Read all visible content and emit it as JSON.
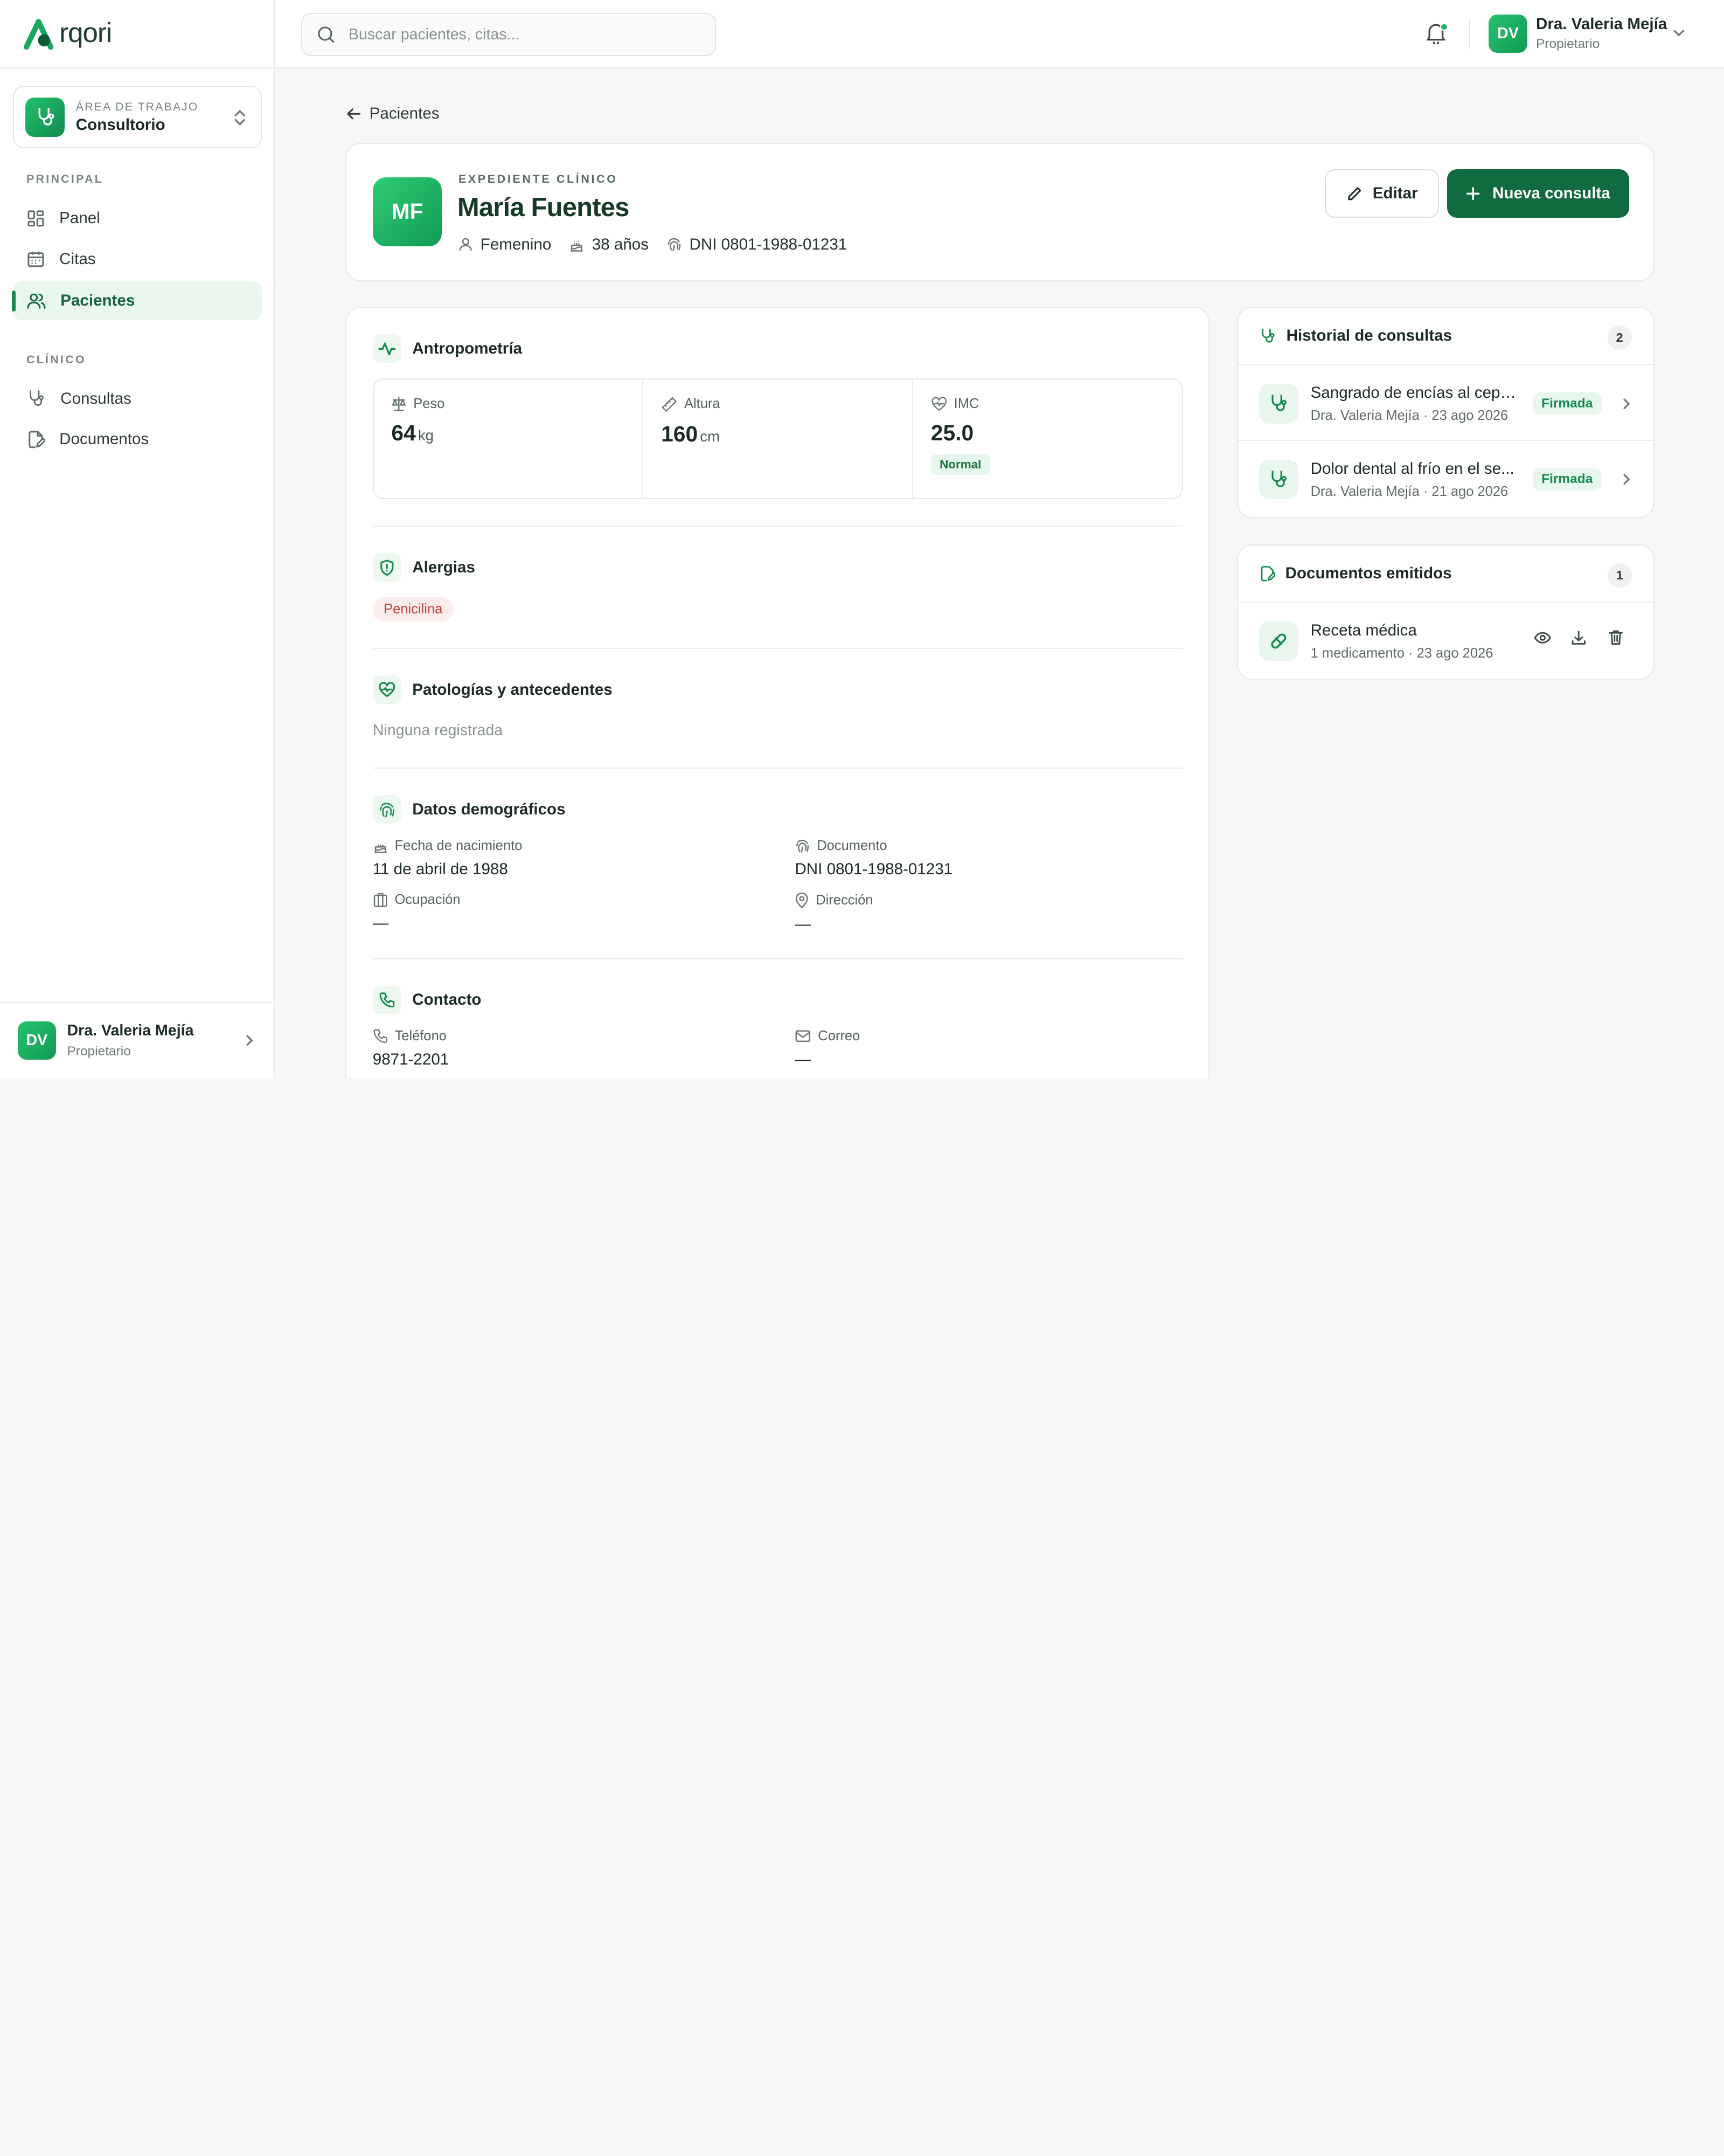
{
  "brand": {
    "name": "rqori",
    "logo_letter": "A"
  },
  "search": {
    "placeholder": "Buscar pacientes, citas..."
  },
  "workspace": {
    "kicker": "ÁREA DE TRABAJO",
    "name": "Consultorio"
  },
  "nav": {
    "principal_label": "PRINCIPAL",
    "principal": [
      {
        "label": "Panel",
        "icon": "grid-icon"
      },
      {
        "label": "Citas",
        "icon": "calendar-icon"
      },
      {
        "label": "Pacientes",
        "icon": "users-icon",
        "active": true
      }
    ],
    "clinico_label": "CLÍNICO",
    "clinico": [
      {
        "label": "Consultas",
        "icon": "stethoscope-icon"
      },
      {
        "label": "Documentos",
        "icon": "document-icon"
      }
    ]
  },
  "user": {
    "initials": "DV",
    "name": "Dra. Valeria Mejía",
    "role": "Propietario"
  },
  "back": {
    "label": "Pacientes"
  },
  "patient": {
    "initials": "MF",
    "kicker": "EXPEDIENTE CLÍNICO",
    "name": "María Fuentes",
    "gender": "Femenino",
    "age": "38 años",
    "dni": "DNI 0801-1988-01231"
  },
  "actions": {
    "edit": "Editar",
    "new_consult": "Nueva consulta"
  },
  "anthropometry": {
    "title": "Antropometría",
    "weight": {
      "label": "Peso",
      "value": "64",
      "unit": "kg"
    },
    "height": {
      "label": "Altura",
      "value": "160",
      "unit": "cm"
    },
    "bmi": {
      "label": "IMC",
      "value": "25.0",
      "status": "Normal"
    }
  },
  "allergies": {
    "title": "Alergias",
    "items": [
      "Penicilina"
    ]
  },
  "pathologies": {
    "title": "Patologías y antecedentes",
    "empty": "Ninguna registrada"
  },
  "demographics": {
    "title": "Datos demográficos",
    "birth": {
      "label": "Fecha de nacimiento",
      "value": "11 de abril de 1988"
    },
    "document": {
      "label": "Documento",
      "value": "DNI 0801-1988-01231"
    },
    "occupation": {
      "label": "Ocupación",
      "value": "—"
    },
    "address": {
      "label": "Dirección",
      "value": "—"
    }
  },
  "contact": {
    "title": "Contacto",
    "phone": {
      "label": "Teléfono",
      "value": "9871-2201"
    },
    "email": {
      "label": "Correo",
      "value": "—"
    }
  },
  "history": {
    "title": "Historial de consultas",
    "count": "2",
    "items": [
      {
        "title": "Sangrado de encías al cepil...",
        "sub": "Dra. Valeria Mejía · 23 ago 2026",
        "status": "Firmada"
      },
      {
        "title": "Dolor dental al frío en el se...",
        "sub": "Dra. Valeria Mejía · 21 ago 2026",
        "status": "Firmada"
      }
    ]
  },
  "documents": {
    "title": "Documentos emitidos",
    "count": "1",
    "items": [
      {
        "title": "Receta médica",
        "sub": "1 medicamento · 23 ago 2026"
      }
    ]
  },
  "colors": {
    "primary": "#116b3f",
    "accent": "#1fb866",
    "danger": "#c2403d"
  }
}
